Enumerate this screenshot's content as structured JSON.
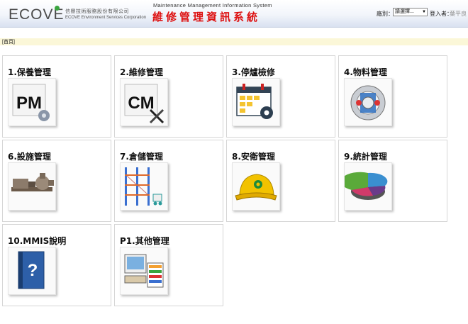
{
  "header": {
    "logo": "ECOVE",
    "company_cn": "信鼎技術服務股份有限公司",
    "company_en": "ECOVE Environment Services Corporation",
    "system_en": "Maintenance Management Information System",
    "system_cn": "維修管理資訊系統",
    "site_label": "廠別：",
    "site_select": "請選擇...",
    "login_label": "登入者：",
    "login_user": "葉平良"
  },
  "breadcrumb": "[首頁]",
  "modules": [
    {
      "label": "1.保養管理",
      "icon": "pm-icon"
    },
    {
      "label": "2.維修管理",
      "icon": "cm-icon"
    },
    {
      "label": "3.停爐檢修",
      "icon": "calendar-gear-icon"
    },
    {
      "label": "4.物料管理",
      "icon": "bearing-icon"
    },
    {
      "label": "6.設施管理",
      "icon": "pump-icon"
    },
    {
      "label": "7.倉儲管理",
      "icon": "warehouse-rack-icon"
    },
    {
      "label": "8.安衛管理",
      "icon": "safety-helmet-icon"
    },
    {
      "label": "9.統計管理",
      "icon": "pie-chart-icon"
    },
    {
      "label": "10.MMIS說明",
      "icon": "help-book-icon"
    },
    {
      "label": "P1.其他管理",
      "icon": "computer-icon"
    }
  ],
  "colors": {
    "title_red": "#dd1111",
    "breadcrumb_bg": "#fbf7d8",
    "logo_green": "#3aa53f"
  }
}
